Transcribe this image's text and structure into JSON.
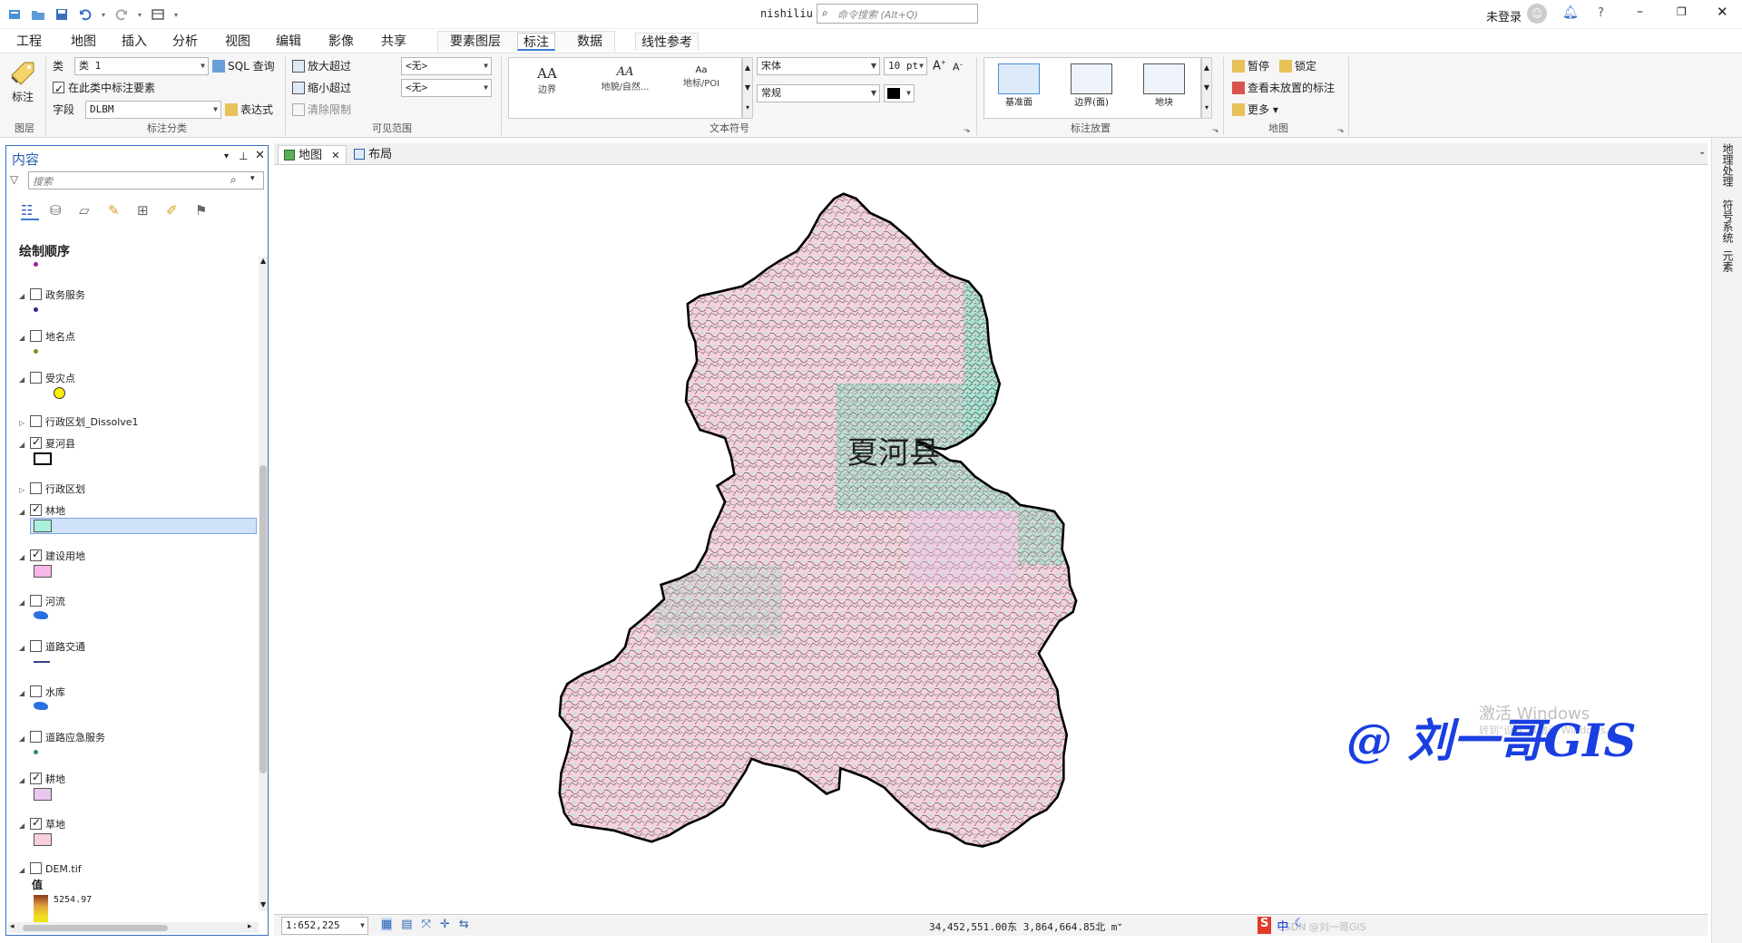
{
  "titlebar": {
    "project_name": "nishiliu",
    "search_placeholder": "命令搜索 (Alt+Q)",
    "signin": "未登录"
  },
  "menus": [
    "工程",
    "地图",
    "插入",
    "分析",
    "视图",
    "编辑",
    "影像",
    "共享"
  ],
  "ctx_tabs": {
    "feature_layer": "要素图层",
    "label": "标注",
    "data": "数据",
    "linear_ref": "线性参考"
  },
  "ribbon": {
    "layer_group": {
      "button": "标注",
      "label": "图层"
    },
    "class_group": {
      "class_label": "类",
      "class_value": "类 1",
      "sql_query": "SQL 查询",
      "label_features_in_class": "在此类中标注要素",
      "field_label": "字段",
      "field_value": "DLBM",
      "expression": "表达式",
      "label": "标注分类"
    },
    "visibility_group": {
      "zoom_in_beyond": "放大超过",
      "zoom_out_beyond": "缩小超过",
      "clear_limits": "清除限制",
      "min_value": "<无>",
      "max_value": "<无>",
      "label": "可见范围"
    },
    "text_symbol_group": {
      "gallery": [
        {
          "sample": "AA",
          "name": "边界"
        },
        {
          "sample": "AA",
          "name": "地貌/自然..."
        },
        {
          "sample": "Aa",
          "name": "地标/POI"
        }
      ],
      "font": "宋体",
      "size": "10 pt",
      "style": "常规",
      "label": "文本符号"
    },
    "placement_group": {
      "items": [
        "基准面",
        "边界(面)",
        "地块"
      ],
      "label": "标注放置"
    },
    "map_group": {
      "pause": "暂停",
      "lock": "锁定",
      "view_unplaced": "查看未放置的标注",
      "more": "更多",
      "label": "地图"
    }
  },
  "contents": {
    "title": "内容",
    "search_placeholder": "搜索",
    "drawing_order": "绘制顺序",
    "layers": [
      {
        "name": "政务服务",
        "checked": false
      },
      {
        "name": "地名点",
        "checked": false
      },
      {
        "name": "受灾点",
        "checked": false
      },
      {
        "name": "行政区划_Dissolve1",
        "checked": false
      },
      {
        "name": "夏河县",
        "checked": true
      },
      {
        "name": "行政区划",
        "checked": false
      },
      {
        "name": "林地",
        "checked": true
      },
      {
        "name": "建设用地",
        "checked": true
      },
      {
        "name": "河流",
        "checked": false
      },
      {
        "name": "道路交通",
        "checked": false
      },
      {
        "name": "水库",
        "checked": false
      },
      {
        "name": "道路应急服务",
        "checked": false
      },
      {
        "name": "耕地",
        "checked": true
      },
      {
        "name": "草地",
        "checked": true
      },
      {
        "name": "DEM.tif",
        "checked": false
      }
    ],
    "dem_value_label": "值",
    "dem_max": "5254.97"
  },
  "view_tabs": {
    "map": "地图",
    "layout": "布局"
  },
  "map": {
    "county_label": "夏河县",
    "watermark_activate": "激活 Windows",
    "watermark_sub": "转到\"设置\"以激活 Windows。",
    "brand": "@ 刘一哥GIS",
    "csdn": "CSDN @刘一哥GIS"
  },
  "statusbar": {
    "scale": "1:652,225",
    "coords": "34,452,551.00东 3,864,664.85北 m"
  },
  "right_dock": [
    "地理处理",
    "符号系统",
    "元素"
  ],
  "colors": {
    "accent": "#3a7bd5",
    "grassland": "#f7d0da",
    "forest": "#a8f0dc",
    "cultivated": "#e8c8f0",
    "boundary": "#000000",
    "road": "#6a6a6a"
  }
}
